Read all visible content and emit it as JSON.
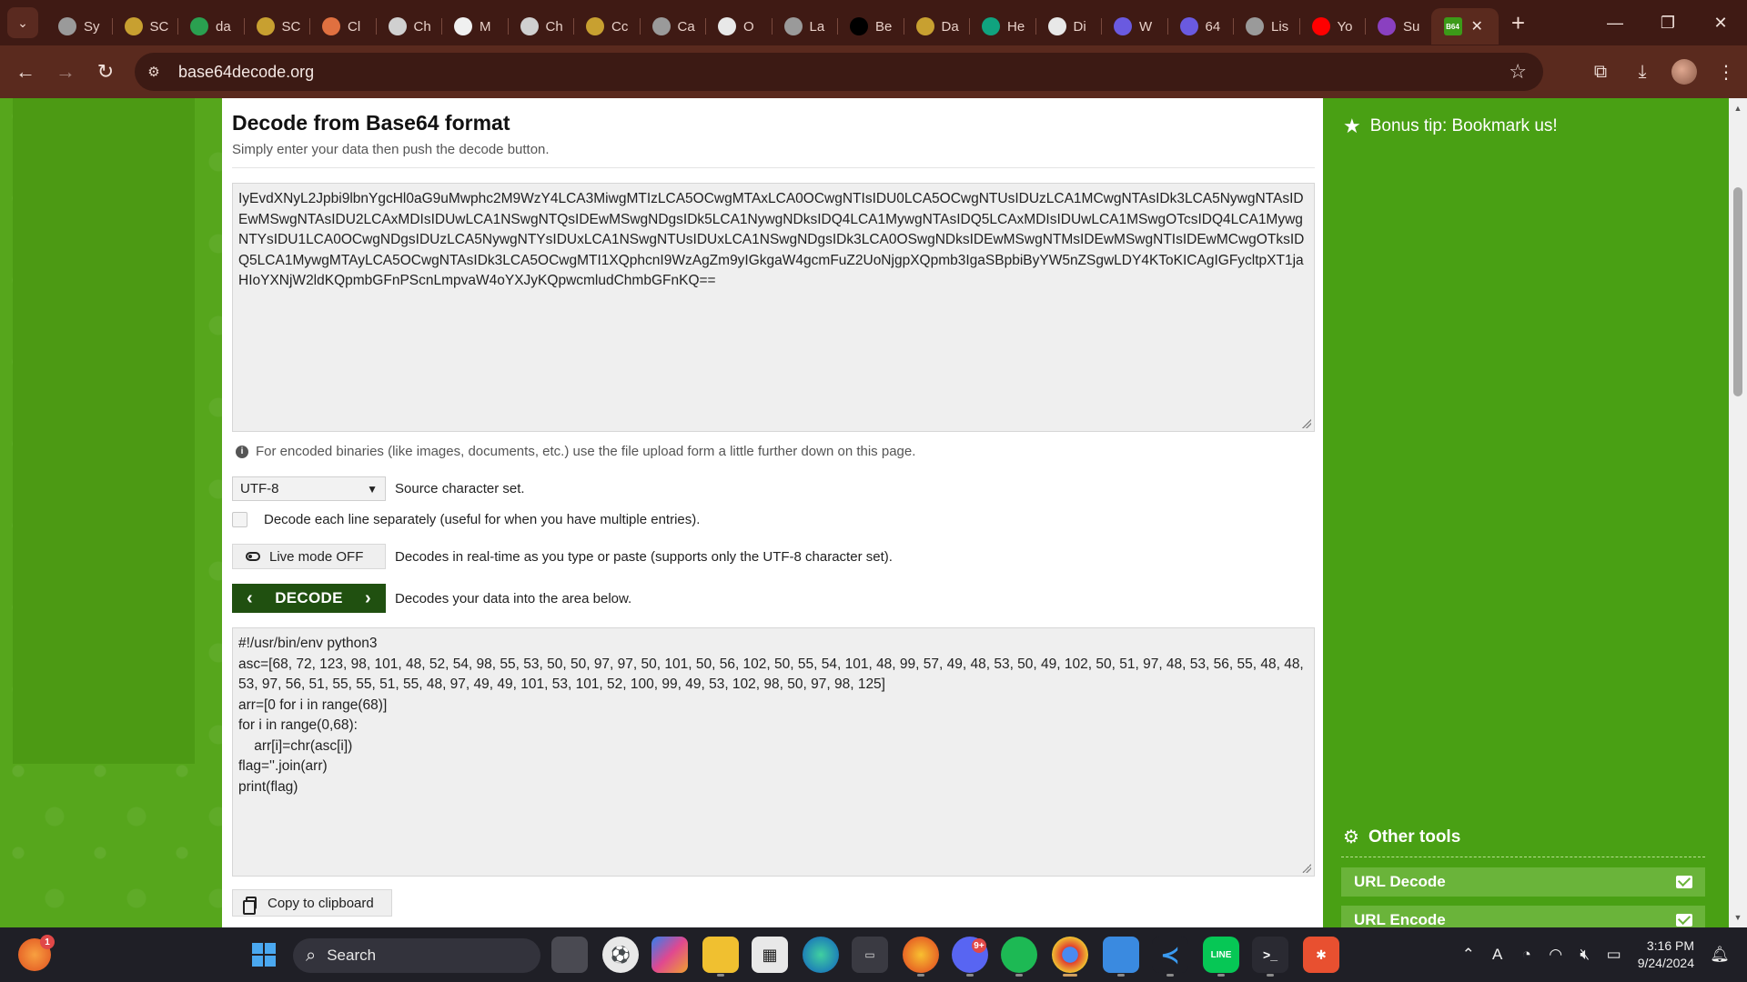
{
  "browser": {
    "tabs": [
      {
        "label": "Sy",
        "icon": "globe-icon",
        "color": "#9a9a9a"
      },
      {
        "label": "SC",
        "icon": "badge-icon",
        "color": "#c8a030"
      },
      {
        "label": "da",
        "icon": "plus-doc-icon",
        "color": "#2aa050"
      },
      {
        "label": "SC",
        "icon": "badge-icon",
        "color": "#c8a030"
      },
      {
        "label": "Cl",
        "icon": "sparkle-icon",
        "color": "#e07040"
      },
      {
        "label": "Ch",
        "icon": "openai-icon",
        "color": "#d0d0d0"
      },
      {
        "label": "M",
        "icon": "feather-icon",
        "color": "#f0f0f0"
      },
      {
        "label": "Ch",
        "icon": "openai-icon",
        "color": "#d0d0d0"
      },
      {
        "label": "Cc",
        "icon": "badge-icon",
        "color": "#c8a030"
      },
      {
        "label": "Ca",
        "icon": "globe-icon",
        "color": "#9a9a9a"
      },
      {
        "label": "O",
        "icon": "chat-bubble-icon",
        "color": "#e8e8e8"
      },
      {
        "label": "La",
        "icon": "globe-icon",
        "color": "#9a9a9a"
      },
      {
        "label": "Be",
        "icon": "x-logo-icon",
        "color": "#000000"
      },
      {
        "label": "Da",
        "icon": "badge-icon",
        "color": "#c8a030"
      },
      {
        "label": "He",
        "icon": "openai-icon",
        "color": "#10a37f"
      },
      {
        "label": "Di",
        "icon": "github-icon",
        "color": "#e8e8e8"
      },
      {
        "label": "W",
        "icon": "shield-icon",
        "color": "#6a5ae0"
      },
      {
        "label": "64",
        "icon": "shield-icon",
        "color": "#6a5ae0"
      },
      {
        "label": "Lis",
        "icon": "globe-icon",
        "color": "#9a9a9a"
      },
      {
        "label": "Yo",
        "icon": "youtube-icon",
        "color": "#ff0000"
      },
      {
        "label": "Su",
        "icon": "search-app-icon",
        "color": "#8a40c0"
      },
      {
        "label": "B64",
        "icon": "base64-icon",
        "color": "#3c9a18",
        "active": true
      }
    ],
    "url": "base64decode.org"
  },
  "page": {
    "title": "Decode from Base64 format",
    "subtitle": "Simply enter your data then push the decode button.",
    "input_text": "IyEvdXNyL2Jpbi9lbnYgcHl0aG9uMwphc2M9WzY4LCA3MiwgMTIzLCA5OCwgMTAxLCA0OCwgNTIsIDU0LCA5OCwgNTUsIDUzLCA1MCwgNTAsIDk3LCA5NywgNTAsIDEwMSwgNTAsIDU2LCAxMDIsIDUwLCA1NSwgNTQsIDEwMSwgNDgsIDk5LCA1NywgNDksIDQ4LCA1MywgNTAsIDQ5LCAxMDIsIDUwLCA1MSwgOTcsIDQ4LCA1MywgNTYsIDU1LCA0OCwgNDgsIDUzLCA5NywgNTYsIDUxLCA1NSwgNTUsIDUxLCA1NSwgNDgsIDk3LCA0OSwgNDksIDEwMSwgNTMsIDEwMSwgNTIsIDEwMCwgOTksIDQ5LCA1MywgMTAyLCA5OCwgNTAsIDk3LCA5OCwgMTI1XQphcnI9WzAgZm9yIGkgaW4gcmFuZ2UoNjgpXQpmb3IgaSBpbiByYW5nZSgwLDY4KToKICAgIGFycltpXT1jaHIoYXNjW2ldKQpmbGFnPScnLmpvaW4oYXJyKQpwcmludChmbGFnKQ==",
    "note": "For encoded binaries (like images, documents, etc.) use the file upload form a little further down on this page.",
    "charset_value": "UTF-8",
    "charset_label": "Source character set.",
    "each_line_label": "Decode each line separately (useful for when you have multiple entries).",
    "live_mode_label": "Live mode OFF",
    "live_mode_desc": "Decodes in real-time as you type or paste (supports only the UTF-8 character set).",
    "decode_label": "DECODE",
    "decode_desc": "Decodes your data into the area below.",
    "output_text": "#!/usr/bin/env python3\nasc=[68, 72, 123, 98, 101, 48, 52, 54, 98, 55, 53, 50, 50, 97, 97, 50, 101, 50, 56, 102, 50, 55, 54, 101, 48, 99, 57, 49, 48, 53, 50, 49, 102, 50, 51, 97, 48, 53, 56, 55, 48, 48, 53, 97, 56, 51, 55, 55, 51, 55, 48, 97, 49, 49, 101, 53, 101, 52, 100, 99, 49, 53, 102, 98, 50, 97, 98, 125]\narr=[0 for i in range(68)]\nfor i in range(0,68):\n    arr[i]=chr(asc[i])\nflag=''.join(arr)\nprint(flag)",
    "copy_label": "Copy to clipboard"
  },
  "sidebar": {
    "bonus_tip": "Bonus tip: Bookmark us!",
    "other_tools_title": "Other tools",
    "tools": [
      "URL Decode",
      "URL Encode"
    ]
  },
  "taskbar": {
    "search_placeholder": "Search",
    "time": "3:16 PM",
    "date": "9/24/2024",
    "discord_badge": "9+",
    "notif_badge": "1"
  },
  "colors": {
    "page_green": "#56a61c",
    "decode_button": "#205010",
    "browser_frame": "#5a2a1e"
  }
}
